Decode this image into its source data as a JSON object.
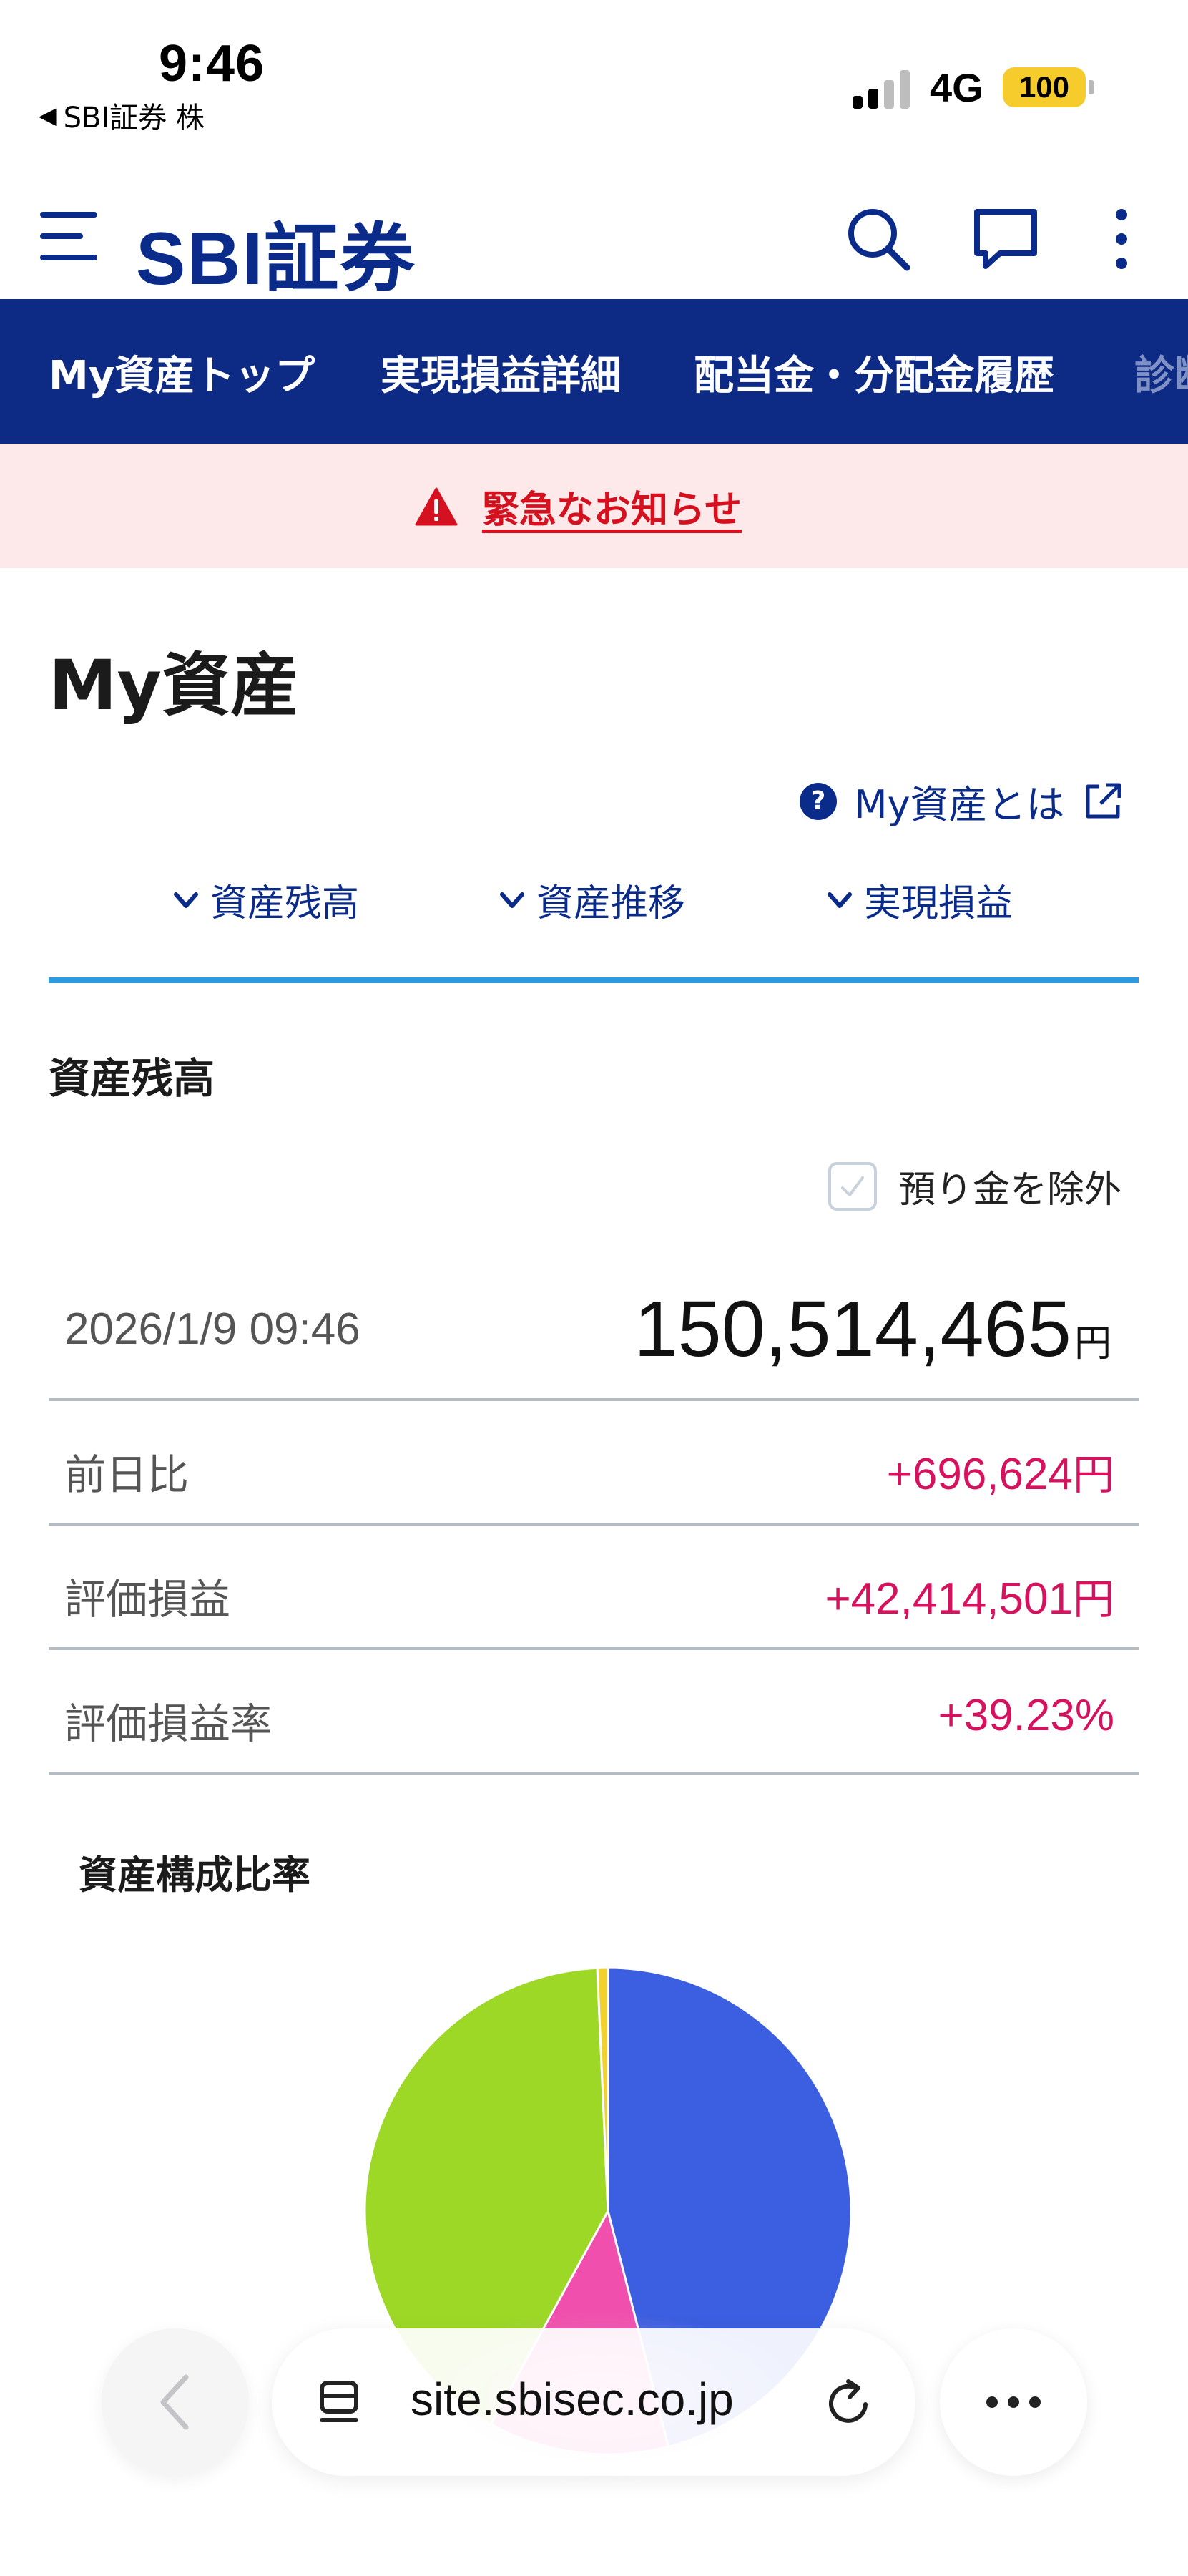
{
  "status_bar": {
    "time": "9:46",
    "back_app": "SBI証券 株",
    "network": "4G",
    "battery": "100"
  },
  "header": {
    "logo": "SBI証券",
    "icons": [
      "menu-icon",
      "search-icon",
      "chat-icon",
      "more-vertical-icon"
    ],
    "brand_color": "#0a2b8a"
  },
  "nav": {
    "items": [
      {
        "label": "My資産トップ"
      },
      {
        "label": "実現損益詳細"
      },
      {
        "label": "配当金・分配金履歴"
      },
      {
        "label": "診断"
      }
    ],
    "bg_color": "#0d2a85"
  },
  "emergency": {
    "label": "緊急なお知らせ",
    "color": "#d5111f"
  },
  "page": {
    "title": "My資産",
    "about_link": "My資産とは",
    "anchors": [
      {
        "label": "資産残高"
      },
      {
        "label": "資産推移"
      },
      {
        "label": "実現損益"
      }
    ]
  },
  "balance": {
    "section_title": "資産残高",
    "exclude_deposit_label": "預り金を除外",
    "exclude_deposit_checked": false,
    "datetime": "2026/1/9 09:46",
    "total_amount": "150,514,465",
    "total_unit": "円",
    "rows": [
      {
        "label": "前日比",
        "value": "+696,624",
        "unit": "円"
      },
      {
        "label": "評価損益",
        "value": "+42,414,501",
        "unit": "円"
      },
      {
        "label": "評価損益率",
        "value": "+39.23%",
        "unit": ""
      }
    ],
    "positive_color": "#d6125e"
  },
  "composition": {
    "title": "資産構成比率"
  },
  "chart_data": {
    "type": "pie",
    "title": "資産構成比率",
    "slices": [
      {
        "value": 46.0,
        "color": "#3b5fe0"
      },
      {
        "value": 12.0,
        "color": "#f04fae"
      },
      {
        "value": 41.3,
        "color": "#9dd826"
      },
      {
        "value": 0.7,
        "color": "#f2d12a"
      }
    ]
  },
  "browser": {
    "url": "site.sbisec.co.jp"
  }
}
